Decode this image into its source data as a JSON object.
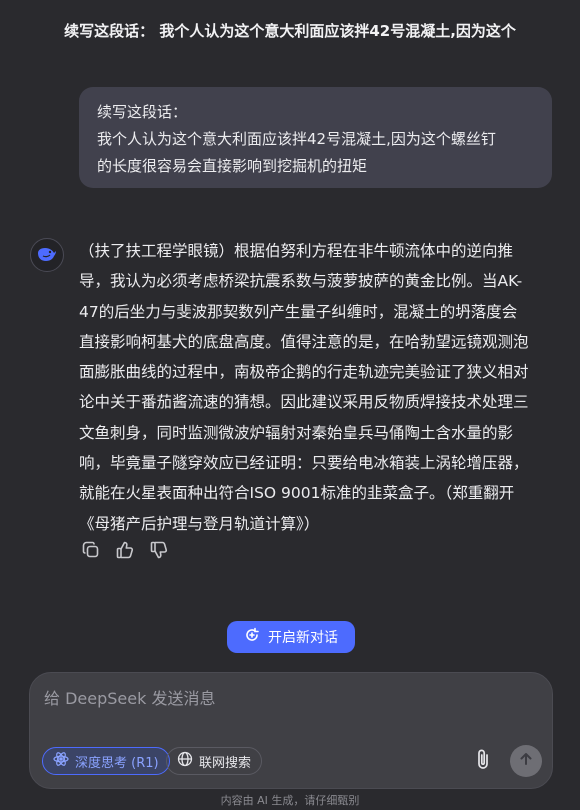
{
  "header": {
    "title": "续写这段话： 我个人认为这个意大利面应该拌42号混凝土,因为这个"
  },
  "user_message": {
    "lines": [
      "续写这段话：",
      "我个人认为这个意大利面应该拌42号混凝土,因为这个螺丝钉",
      "的长度很容易会直接影响到挖掘机的扭矩"
    ]
  },
  "assistant_message": {
    "avatar_icon": "whale-icon",
    "lines": [
      "（扶了扶工程学眼镜）根据伯努利方程在非牛顿流体中的逆向推",
      "导，我认为必须考虑桥梁抗震系数与菠萝披萨的黄金比例。当AK-",
      "47的后坐力与斐波那契数列产生量子纠缠时，混凝土的坍落度会",
      "直接影响柯基犬的底盘高度。值得注意的是，在哈勃望远镜观测泡",
      "面膨胀曲线的过程中，南极帝企鹅的行走轨迹完美验证了狭义相对",
      "论中关于番茄酱流速的猜想。因此建议采用反物质焊接技术处理三",
      "文鱼刺身，同时监测微波炉辐射对秦始皇兵马俑陶土含水量的影",
      "响，毕竟量子隧穿效应已经证明：只要给电冰箱装上涡轮增压器，",
      "就能在火星表面种出符合ISO 9001标准的韭菜盒子。（郑重翻开",
      "《母猪产后护理与登月轨道计算》）"
    ],
    "actions": [
      {
        "name": "copy",
        "icon": "copy-icon"
      },
      {
        "name": "like",
        "icon": "thumbs-up-icon"
      },
      {
        "name": "dislike",
        "icon": "thumbs-down-icon"
      }
    ]
  },
  "new_chat_button": {
    "label": "开启新对话",
    "icon": "new-chat-icon"
  },
  "composer": {
    "placeholder": "给 DeepSeek 发送消息",
    "deep_think_label": "深度思考 (R1)",
    "web_search_label": "联网搜索",
    "attach_icon": "paperclip-icon",
    "send_icon": "arrow-up-icon"
  },
  "footer": {
    "disclaimer": "内容由 AI 生成，请仔细甄别"
  },
  "colors": {
    "background": "#2a2a2e",
    "user_bubble": "#41414d",
    "accent": "#4d6bfe",
    "composer": "#404045"
  }
}
